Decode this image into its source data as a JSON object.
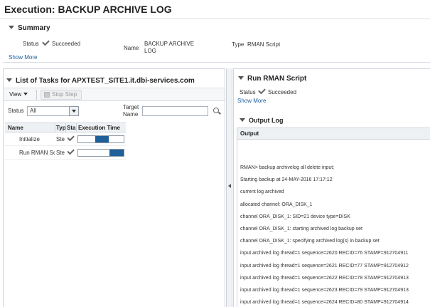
{
  "page": {
    "title": "Execution: BACKUP ARCHIVE LOG"
  },
  "summary": {
    "heading": "Summary",
    "status_label": "Status",
    "status_value": "Succeeded",
    "name_label": "Name",
    "name_value_line1": "BACKUP ARCHIVE",
    "name_value_line2": "LOG",
    "type_label": "Type",
    "type_value": "RMAN Script",
    "show_more": "Show More"
  },
  "tasks": {
    "heading": "List of Tasks for APXTEST_SITE1.it.dbi-services.com",
    "view_label": "View",
    "stop_step_label": "Stop Step",
    "status_filter_label": "Status",
    "status_filter_value": "All",
    "target_name_label_line1": "Target",
    "target_name_label_line2": "Name",
    "target_name_value": "",
    "columns": {
      "name": "Name",
      "type": "Typ",
      "status": "Sta",
      "execution_time": "Execution Time"
    },
    "rows": [
      {
        "name": "Initialize",
        "type": "Ste",
        "bar_start": 0.38,
        "bar_width": 0.3
      },
      {
        "name": "Run RMAN Sc",
        "type": "Ste",
        "bar_start": 0.68,
        "bar_width": 0.32
      }
    ],
    "bar_color": "#1f5f9a"
  },
  "run": {
    "heading": "Run RMAN Script",
    "status_label": "Status",
    "status_value": "Succeeded",
    "show_more": "Show More"
  },
  "output": {
    "heading": "Output Log",
    "column": "Output",
    "lines": [
      "RMAN> backup archivelog all delete input;",
      "Starting backup at 24-MAY-2016 17:17:12",
      "current log archived",
      "allocated channel: ORA_DISK_1",
      "channel ORA_DISK_1: SID=21 device type=DISK",
      "channel ORA_DISK_1: starting archived log backup set",
      "channel ORA_DISK_1: specifying archived log(s) in backup set",
      "input archived log thread=1 sequence=2620 RECID=76 STAMP=912704911",
      "input archived log thread=1 sequence=2621 RECID=77 STAMP=912704912",
      "input archived log thread=1 sequence=2622 RECID=78 STAMP=912704913",
      "input archived log thread=1 sequence=2623 RECID=79 STAMP=912704913",
      "input archived log thread=1 sequence=2624 RECID=80 STAMP=912704914"
    ]
  }
}
